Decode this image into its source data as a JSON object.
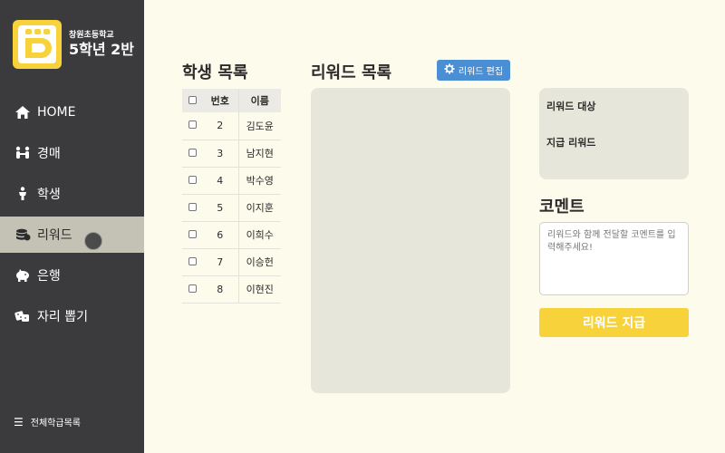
{
  "sidebar": {
    "school": "창원초등학교",
    "class_name": "5학년 2반",
    "items": [
      {
        "label": "HOME",
        "icon": "home-icon"
      },
      {
        "label": "경매",
        "icon": "people-icon"
      },
      {
        "label": "학생",
        "icon": "person-icon"
      },
      {
        "label": "리워드",
        "icon": "coins-icon",
        "active": true
      },
      {
        "label": "은행",
        "icon": "piggy-bank-icon"
      },
      {
        "label": "자리 뽑기",
        "icon": "dice-icon"
      }
    ],
    "footer": "전체학급목록"
  },
  "students": {
    "title": "학생 목록",
    "headers": {
      "num": "번호",
      "name": "이름"
    },
    "rows": [
      {
        "num": "2",
        "name": "김도윤"
      },
      {
        "num": "3",
        "name": "남지현"
      },
      {
        "num": "4",
        "name": "박수영"
      },
      {
        "num": "5",
        "name": "이지훈"
      },
      {
        "num": "6",
        "name": "이희수"
      },
      {
        "num": "7",
        "name": "이승헌"
      },
      {
        "num": "8",
        "name": "이현진"
      }
    ]
  },
  "rewards": {
    "title": "리워드 목록",
    "edit_label": "리워드 편집"
  },
  "info": {
    "target_label": "리워드 대상",
    "amount_label": "지급 리워드"
  },
  "comment": {
    "title": "코멘트",
    "placeholder": "리워드와 함께 전달할 코멘트를 입력해주세요!"
  },
  "pay_label": "리워드 지급",
  "colors": {
    "sidebar_bg": "#3b3a3c",
    "page_bg": "#fcfbec",
    "accent_yellow": "#f7d23b",
    "edit_blue": "#4a8fd4",
    "panel_bg": "#e7e6da"
  }
}
